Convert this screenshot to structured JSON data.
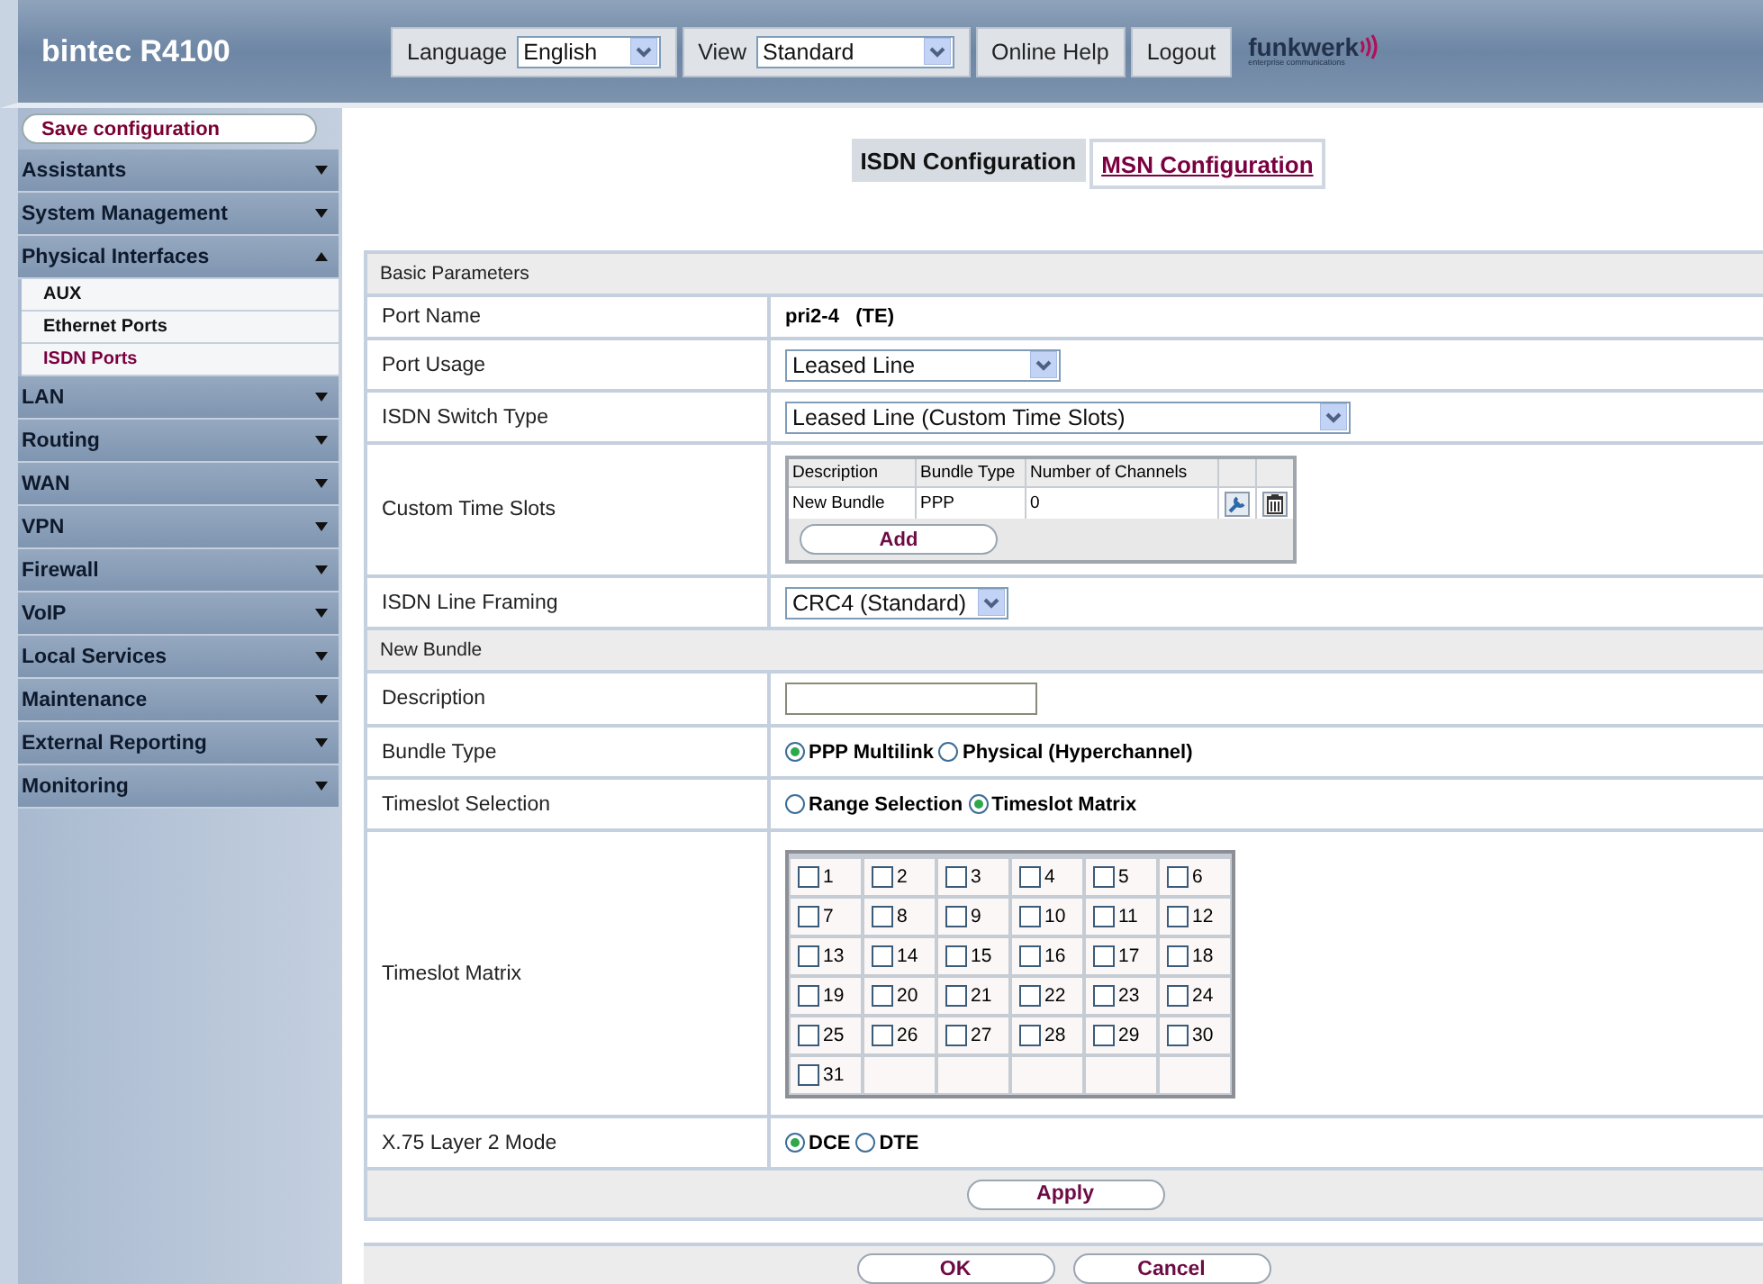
{
  "header": {
    "product": "bintec R4100",
    "language": {
      "label": "Language",
      "value": "English"
    },
    "view": {
      "label": "View",
      "value": "Standard"
    },
    "links": [
      "Online Help",
      "Logout"
    ],
    "logo": {
      "name": "funkwerk",
      "tagline": "enterprise communications"
    }
  },
  "sidebar": {
    "save_button": "Save configuration",
    "items": [
      {
        "label": "Assistants",
        "expanded": false
      },
      {
        "label": "System Management",
        "expanded": false
      },
      {
        "label": "Physical Interfaces",
        "expanded": true,
        "children": [
          {
            "label": "AUX",
            "selected": false
          },
          {
            "label": "Ethernet Ports",
            "selected": false
          },
          {
            "label": "ISDN Ports",
            "selected": true
          }
        ]
      },
      {
        "label": "LAN",
        "expanded": false
      },
      {
        "label": "Routing",
        "expanded": false
      },
      {
        "label": "WAN",
        "expanded": false
      },
      {
        "label": "VPN",
        "expanded": false
      },
      {
        "label": "Firewall",
        "expanded": false
      },
      {
        "label": "VoIP",
        "expanded": false
      },
      {
        "label": "Local Services",
        "expanded": false
      },
      {
        "label": "Maintenance",
        "expanded": false
      },
      {
        "label": "External Reporting",
        "expanded": false
      },
      {
        "label": "Monitoring",
        "expanded": false
      }
    ]
  },
  "tabs": [
    {
      "label": "ISDN Configuration",
      "selected": true
    },
    {
      "label": "MSN Configuration",
      "selected": false
    }
  ],
  "sections": [
    {
      "title": "Basic Parameters",
      "rows": [
        {
          "label": "Port Name",
          "kind": "text",
          "value": "pri2-4   (TE)"
        },
        {
          "label": "Port Usage",
          "kind": "select",
          "value": "Leased Line",
          "wide": false
        },
        {
          "label": "ISDN Switch Type",
          "kind": "select",
          "value": "Leased Line (Custom Time Slots)",
          "wide": true
        },
        {
          "label": "Custom Time Slots",
          "kind": "table",
          "columns": [
            "Description",
            "Bundle Type",
            "Number of Channels"
          ],
          "rows": [
            [
              "New Bundle",
              "PPP",
              "0"
            ]
          ],
          "button": "Add"
        },
        {
          "label": "ISDN Line Framing",
          "kind": "select",
          "value": "CRC4 (Standard)",
          "wide": false
        }
      ]
    },
    {
      "title": "New Bundle",
      "rows": [
        {
          "label": "Description",
          "kind": "input",
          "value": ""
        },
        {
          "label": "Bundle Type",
          "kind": "radio",
          "options": [
            {
              "label": "PPP Multilink",
              "selected": true
            },
            {
              "label": "Physical (Hyperchannel)",
              "selected": false
            }
          ]
        },
        {
          "label": "Timeslot Selection",
          "kind": "radio",
          "options": [
            {
              "label": "Range Selection",
              "selected": false
            },
            {
              "label": "Timeslot Matrix",
              "selected": true
            }
          ]
        },
        {
          "label": "Timeslot Matrix",
          "kind": "matrix",
          "slots": [
            {
              "label": "1",
              "checked": false
            },
            {
              "label": "2",
              "checked": false
            },
            {
              "label": "3",
              "checked": false
            },
            {
              "label": "4",
              "checked": false
            },
            {
              "label": "5",
              "checked": false
            },
            {
              "label": "6",
              "checked": false
            },
            {
              "label": "7",
              "checked": false
            },
            {
              "label": "8",
              "checked": false
            },
            {
              "label": "9",
              "checked": false
            },
            {
              "label": "10",
              "checked": false
            },
            {
              "label": "11",
              "checked": false
            },
            {
              "label": "12",
              "checked": false
            },
            {
              "label": "13",
              "checked": false
            },
            {
              "label": "14",
              "checked": false
            },
            {
              "label": "15",
              "checked": false
            },
            {
              "label": "16",
              "checked": false
            },
            {
              "label": "17",
              "checked": false
            },
            {
              "label": "18",
              "checked": false
            },
            {
              "label": "19",
              "checked": false
            },
            {
              "label": "20",
              "checked": false
            },
            {
              "label": "21",
              "checked": false
            },
            {
              "label": "22",
              "checked": false
            },
            {
              "label": "23",
              "checked": false
            },
            {
              "label": "24",
              "checked": false
            },
            {
              "label": "25",
              "checked": false
            },
            {
              "label": "26",
              "checked": false
            },
            {
              "label": "27",
              "checked": false
            },
            {
              "label": "28",
              "checked": false
            },
            {
              "label": "29",
              "checked": false
            },
            {
              "label": "30",
              "checked": false
            },
            {
              "label": "31",
              "checked": false
            }
          ]
        },
        {
          "label": "X.75 Layer 2 Mode",
          "kind": "radio",
          "options": [
            {
              "label": "DCE",
              "selected": true
            },
            {
              "label": "DTE",
              "selected": false
            }
          ]
        }
      ]
    }
  ],
  "apply_button": "Apply",
  "footer_buttons": [
    "OK",
    "Cancel"
  ]
}
